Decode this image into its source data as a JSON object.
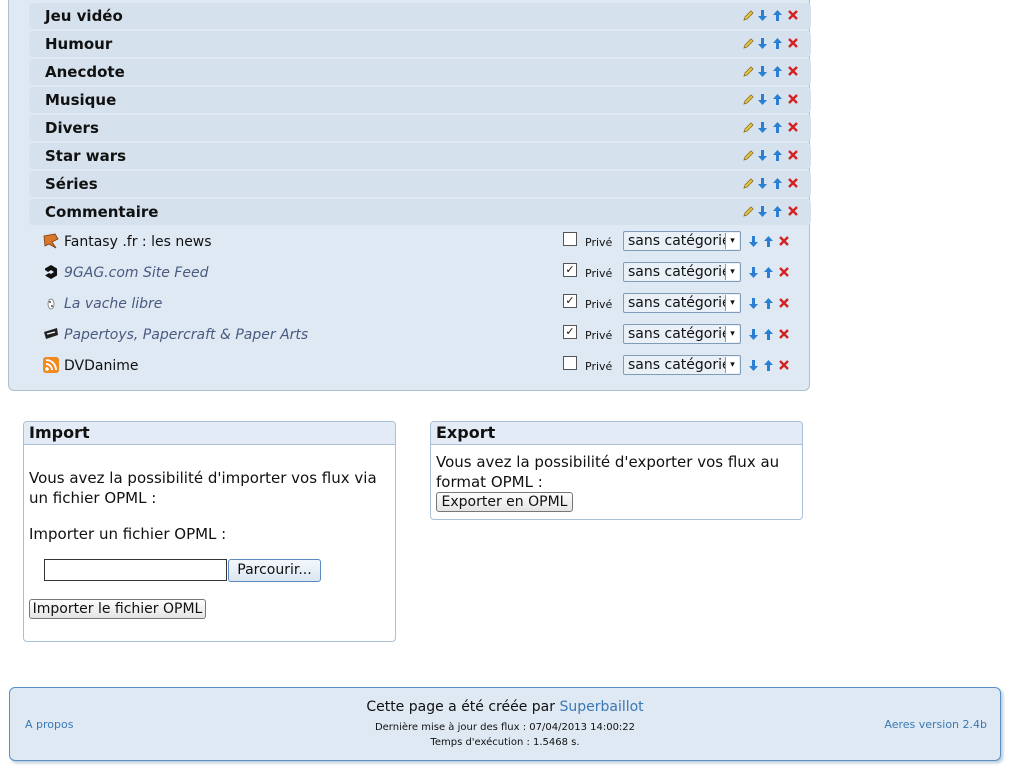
{
  "categories": [
    {
      "label": "Jeu vidéo"
    },
    {
      "label": "Humour"
    },
    {
      "label": "Anecdote"
    },
    {
      "label": "Musique"
    },
    {
      "label": "Divers"
    },
    {
      "label": "Star wars"
    },
    {
      "label": "Séries"
    },
    {
      "label": "Commentaire"
    }
  ],
  "feeds": [
    {
      "title": "Fantasy .fr : les news",
      "private_checked": false,
      "private_label": "Privé",
      "category": "sans catégorie",
      "italic": false,
      "icon": "fantasy-feed-icon"
    },
    {
      "title": "9GAG.com Site Feed",
      "private_checked": true,
      "private_label": "Privé",
      "category": "sans catégorie",
      "italic": true,
      "icon": "9gag-feed-icon"
    },
    {
      "title": "La vache libre",
      "private_checked": true,
      "private_label": "Privé",
      "category": "sans catégorie",
      "italic": true,
      "icon": "vache-feed-icon"
    },
    {
      "title": "Papertoys, Papercraft & Paper Arts",
      "private_checked": true,
      "private_label": "Privé",
      "category": "sans catégorie",
      "italic": true,
      "icon": "papertoys-feed-icon"
    },
    {
      "title": "DVDanime",
      "private_checked": false,
      "private_label": "Privé",
      "category": "sans catégorie",
      "italic": false,
      "icon": "rss-feed-icon"
    }
  ],
  "import_box": {
    "title": "Import",
    "text": "Vous avez la possibilité d'importer vos flux via un fichier OPML :",
    "file_label": "Importer un fichier OPML :",
    "browse_label": "Parcourir...",
    "submit_label": "Importer le fichier OPML",
    "file_value": ""
  },
  "export_box": {
    "title": "Export",
    "text": "Vous avez la possibilité d'exporter vos flux au format OPML :",
    "button_label": "Exporter en OPML"
  },
  "footer": {
    "about": "A propos",
    "created_prefix": "Cette page a été créée par",
    "author": "Superbaillot",
    "last_update": "Dernière mise à jour des flux : 07/04/2013 14:00:22",
    "exec_time": "Temps d'exécution : 1.5468 s.",
    "version": "Aeres version 2.4b"
  },
  "colors": {
    "panel_bg": "#dfe9f3",
    "row_bg": "#d5e1ec",
    "link": "#3a78b5",
    "delete": "#d22222",
    "arrow": "#2a7fd4"
  }
}
